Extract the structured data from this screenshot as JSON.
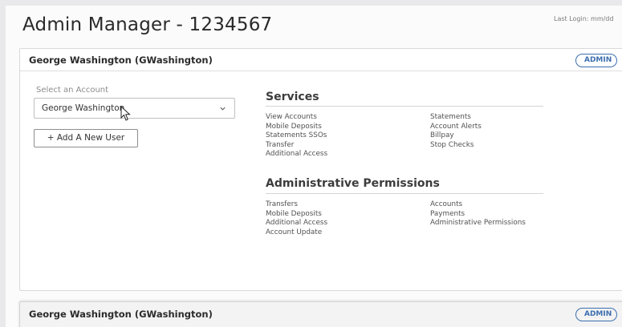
{
  "header": {
    "title": "Admin Manager - 1234567",
    "last_login": "Last Login: mm/dd"
  },
  "user_card": {
    "name": "George Washington (GWashington)",
    "badge": "ADMIN",
    "select_label": "Select an Account",
    "selected_account": "George Washington",
    "add_user_button": "+ Add A New User"
  },
  "services": {
    "heading": "Services",
    "left": [
      "View Accounts",
      "Mobile Deposits",
      "Statements SSOs",
      "Transfer",
      "Additional Access"
    ],
    "right": [
      "Statements",
      "Account Alerts",
      "Billpay",
      "Stop Checks"
    ]
  },
  "admin_permissions": {
    "heading": "Administrative Permissions",
    "left": [
      "Transfers",
      "Mobile Deposits",
      "Additional Access",
      "Account Update"
    ],
    "right": [
      "Accounts",
      "Payments",
      "Administrative Permissions"
    ]
  },
  "bottom_card": {
    "name": "George Washington (GWashington)",
    "badge": "ADMIN"
  },
  "colors": {
    "accent": "#3d6fb0",
    "background": "#e9e9eb",
    "card": "#ffffff"
  },
  "icons": {
    "select_chevron": "chevron-down-icon",
    "pointer": "cursor-icon"
  }
}
